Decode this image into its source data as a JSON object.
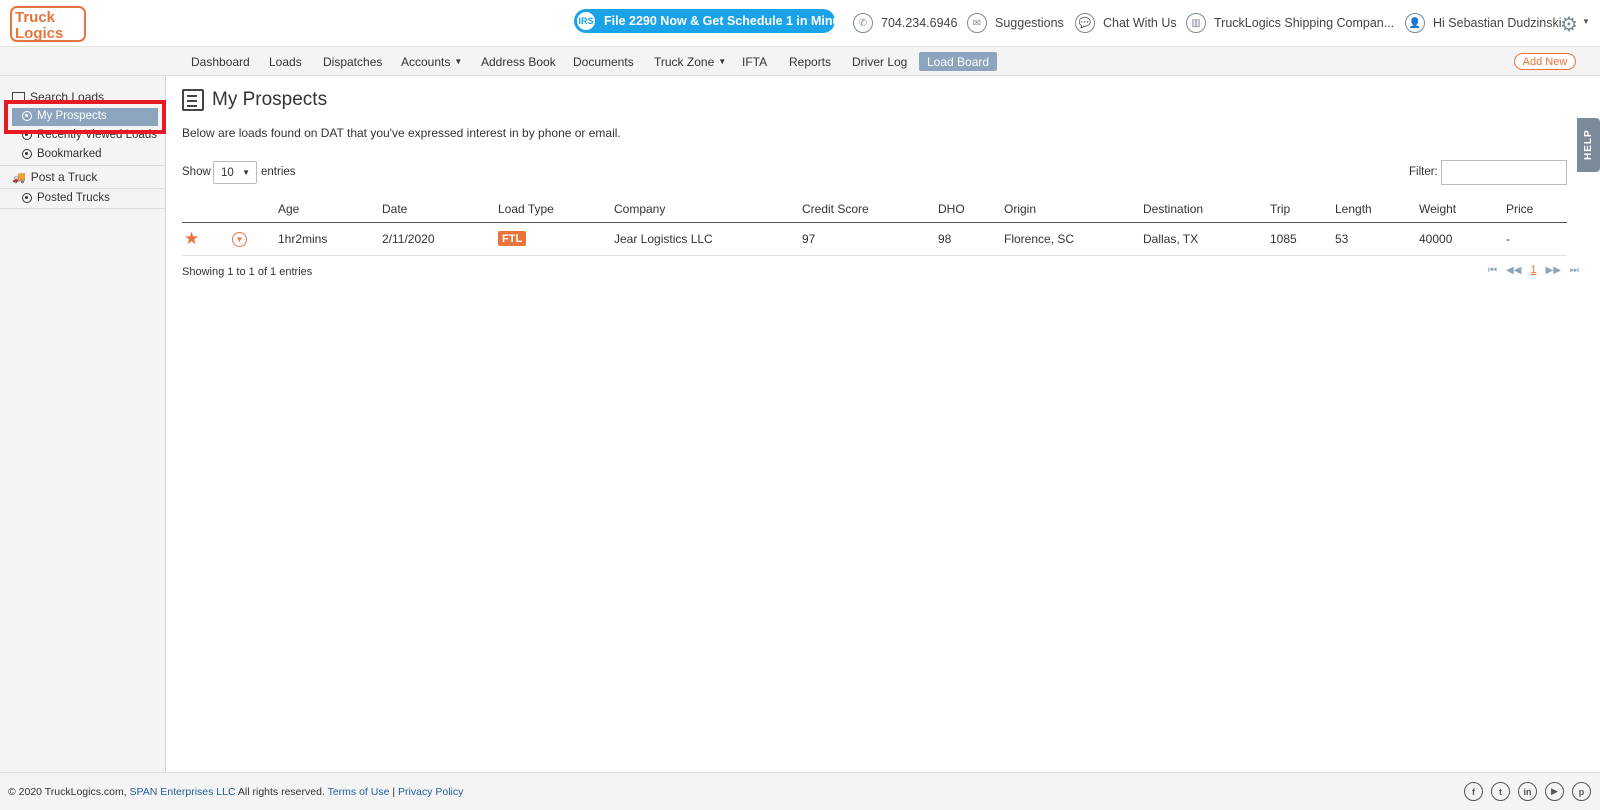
{
  "header": {
    "logo": {
      "line1": "Truck",
      "line2": "Logics"
    },
    "promo": {
      "icon_text": "IRS",
      "label": "File 2290 Now & Get Schedule 1 in Minutes"
    },
    "phone": "704.234.6946",
    "suggestions": "Suggestions",
    "chat": "Chat With Us",
    "company": "TruckLogics Shipping Compan...",
    "greeting": "Hi Sebastian Dudzinski"
  },
  "nav": {
    "items": [
      "Dashboard",
      "Loads",
      "Dispatches",
      "Accounts",
      "Address Book",
      "Documents",
      "Truck Zone",
      "IFTA",
      "Reports",
      "Driver Log",
      "Load Board"
    ],
    "active": "Load Board",
    "add_new": "Add New"
  },
  "sidebar": {
    "search_loads": "Search Loads",
    "my_prospects": "My Prospects",
    "recently_viewed": "Recently Viewed Loads",
    "bookmarked": "Bookmarked",
    "post_truck": "Post a Truck",
    "posted_trucks": "Posted Trucks"
  },
  "main": {
    "title": "My Prospects",
    "description": "Below are loads found on DAT that you've expressed interest in by phone or email.",
    "show_label": "Show",
    "show_value": "10",
    "entries_label": "entries",
    "filter_label": "Filter:",
    "columns": [
      "Age",
      "Date",
      "Load Type",
      "Company",
      "Credit Score",
      "DHO",
      "Origin",
      "Destination",
      "Trip",
      "Length",
      "Weight",
      "Price"
    ],
    "rows": [
      {
        "age": "1hr2mins",
        "date": "2/11/2020",
        "load_type": "FTL",
        "company": "Jear Logistics LLC",
        "credit_score": "97",
        "dho": "98",
        "origin": "Florence, SC",
        "destination": "Dallas, TX",
        "trip": "1085",
        "length": "53",
        "weight": "40000",
        "price": "-"
      }
    ],
    "showing": "Showing 1 to 1 of 1 entries",
    "page": "1"
  },
  "help": "HELP",
  "footer": {
    "copyright": "© 2020 TruckLogics.com,",
    "span": "SPAN Enterprises LLC",
    "rights": "All rights reserved.",
    "terms": "Terms of Use",
    "separator": "|",
    "privacy": "Privacy Policy",
    "socials": [
      "f",
      "t",
      "in",
      "▶",
      "p"
    ]
  },
  "colors": {
    "accent": "#e8743b",
    "active_nav": "#8ca4bd",
    "promo": "#1aa3e8",
    "highlight_box": "#e51a22"
  }
}
